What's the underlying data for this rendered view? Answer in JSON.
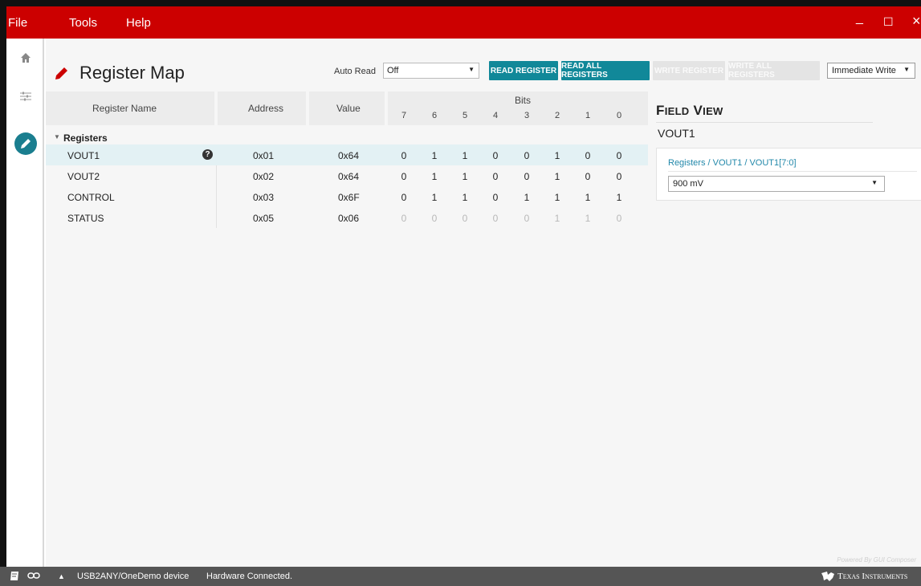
{
  "menubar": {
    "items": [
      "File",
      "Tools",
      "Help"
    ],
    "window_controls": {
      "minimize": "_",
      "maximize": "☐",
      "close": "×"
    }
  },
  "leftnav": {
    "items": [
      {
        "icon": "home-icon"
      },
      {
        "icon": "sliders-icon"
      },
      {
        "icon": "pencil-icon",
        "active": true
      }
    ]
  },
  "header": {
    "title": "Register Map",
    "auto_read_label": "Auto Read",
    "auto_read_value": "Off",
    "buttons": {
      "read_register": "READ REGISTER",
      "read_all_registers": "READ ALL REGISTERS",
      "write_register": "WRITE REGISTER",
      "write_all_registers": "WRITE ALL REGISTERS"
    },
    "write_mode": "Immediate Write"
  },
  "table": {
    "columns": {
      "name": "Register Name",
      "address": "Address",
      "value": "Value",
      "bits": "Bits",
      "bit_labels": [
        "7",
        "6",
        "5",
        "4",
        "3",
        "2",
        "1",
        "0"
      ]
    },
    "group": "Registers",
    "rows": [
      {
        "name": "VOUT1",
        "address": "0x01",
        "value": "0x64",
        "bits": [
          "0",
          "1",
          "1",
          "0",
          "0",
          "1",
          "0",
          "0"
        ],
        "selected": true,
        "help": "?"
      },
      {
        "name": "VOUT2",
        "address": "0x02",
        "value": "0x64",
        "bits": [
          "0",
          "1",
          "1",
          "0",
          "0",
          "1",
          "0",
          "0"
        ]
      },
      {
        "name": "CONTROL",
        "address": "0x03",
        "value": "0x6F",
        "bits": [
          "0",
          "1",
          "1",
          "0",
          "1",
          "1",
          "1",
          "1"
        ]
      },
      {
        "name": "STATUS",
        "address": "0x05",
        "value": "0x06",
        "bits": [
          "0",
          "0",
          "0",
          "0",
          "0",
          "1",
          "1",
          "0"
        ],
        "read_only": true
      }
    ]
  },
  "field_view": {
    "title_f": "F",
    "title_ield": "IELD",
    "title_v": "V",
    "title_iew": "IEW",
    "register": "VOUT1",
    "path": "Registers / VOUT1 / VOUT1[7:0]",
    "selected_value": "900 mV"
  },
  "powered_by": "Powered By GUI Composer",
  "statusbar": {
    "arrow": "▲",
    "device": "USB2ANY/OneDemo device",
    "connection": "Hardware Connected.",
    "brand": "Texas Instruments"
  },
  "colors": {
    "brand_red": "#cc0000",
    "accent_teal": "#118899",
    "nav_active": "#1a7e8f",
    "status_bar": "#555555"
  }
}
